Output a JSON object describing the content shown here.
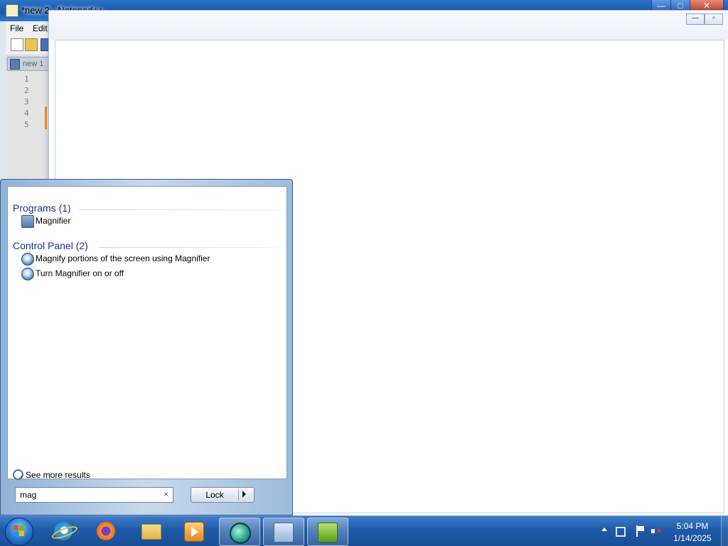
{
  "notepad": {
    "title": "*new 2 - Notepad++",
    "menu": [
      "File",
      "Edit"
    ],
    "tab_label": "new 1",
    "line_numbers": [
      "1",
      "2",
      "3",
      "4",
      "5"
    ]
  },
  "magnifier": {
    "caption_min": "—",
    "caption_max": "▫"
  },
  "start_menu": {
    "groups": [
      {
        "title": "Programs (1)",
        "items": [
          {
            "label": "Magnifier",
            "icon": "magnifier-icon"
          }
        ]
      },
      {
        "title": "Control Panel (2)",
        "items": [
          {
            "label": "Magnify portions of the screen using Magnifier",
            "icon": "control-panel-icon"
          },
          {
            "label": "Turn Magnifier on or off",
            "icon": "control-panel-icon"
          }
        ]
      }
    ],
    "see_more": "See more results",
    "search": {
      "value": "mag",
      "clear_glyph": "×"
    },
    "lock_button": "Lock"
  },
  "taskbar": {
    "pinned": [
      "internet-explorer",
      "firefox",
      "file-explorer",
      "media-player",
      "magnifier",
      "remote-desktop",
      "notepad++"
    ],
    "time": "5:04 PM",
    "date": "1/14/2025"
  },
  "colors": {
    "accent_group": "#1e3287",
    "taskbar": "#1e5aa8",
    "change_marker": "#ff8c00"
  }
}
